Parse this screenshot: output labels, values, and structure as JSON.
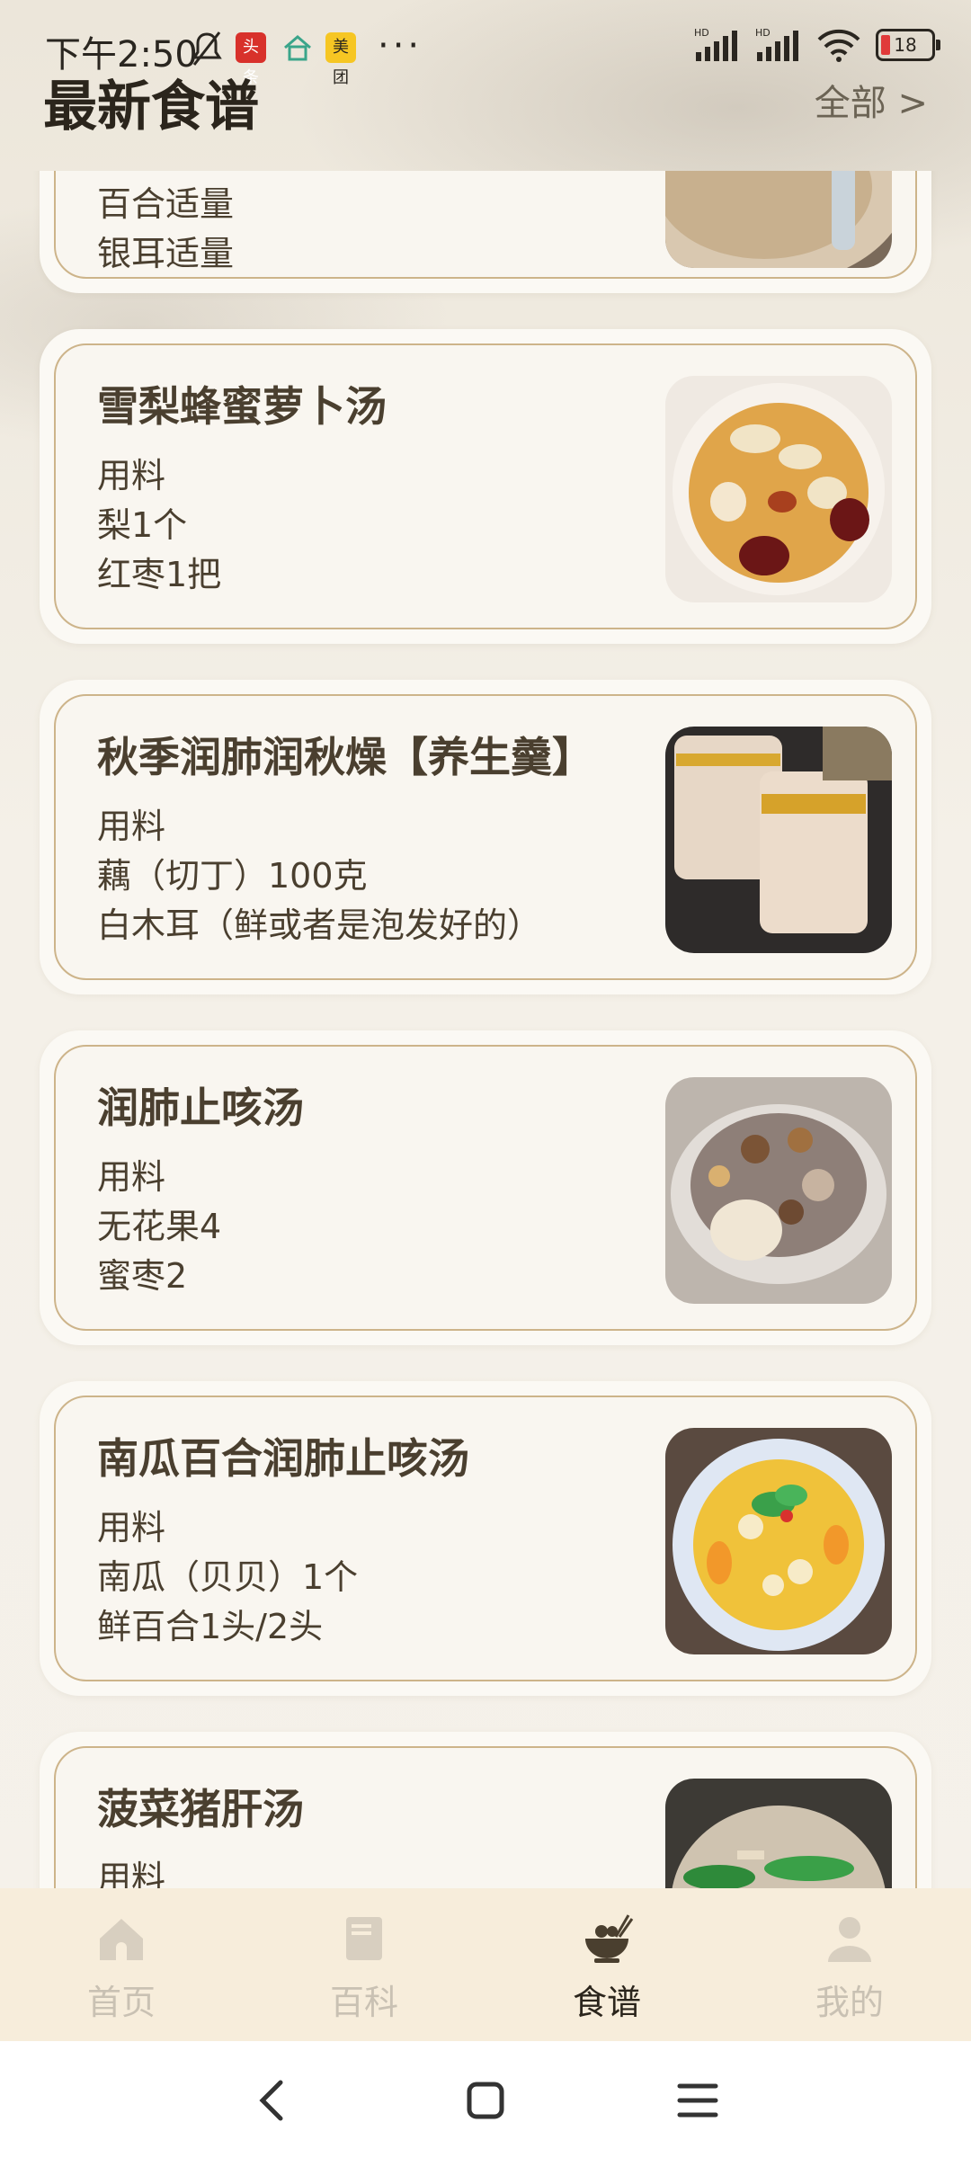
{
  "status_bar": {
    "time": "下午2:50",
    "app_badges": [
      "头条",
      "美团"
    ],
    "more": "···",
    "battery": "18"
  },
  "header": {
    "title": "最新食谱",
    "see_all": "全部 >"
  },
  "recipes": [
    {
      "title": "",
      "lines": [
        "百合适量",
        "银耳适量"
      ]
    },
    {
      "title": "雪梨蜂蜜萝卜汤",
      "lines": [
        "用料",
        "梨1个",
        "红枣1把"
      ]
    },
    {
      "title": "秋季润肺润秋燥【养生羹】",
      "lines": [
        "用料",
        "藕（切丁）100克",
        "白木耳（鲜或者是泡发好的）"
      ]
    },
    {
      "title": "润肺止咳汤",
      "lines": [
        "用料",
        "无花果4",
        "蜜枣2"
      ]
    },
    {
      "title": "南瓜百合润肺止咳汤",
      "lines": [
        "用料",
        "南瓜（贝贝）1个",
        "鲜百合1头/2头"
      ]
    },
    {
      "title": "菠菜猪肝汤",
      "lines": [
        "用料"
      ]
    }
  ],
  "tabs": [
    {
      "label": "首页",
      "icon": "home-icon"
    },
    {
      "label": "百科",
      "icon": "book-icon"
    },
    {
      "label": "食谱",
      "icon": "bowl-icon"
    },
    {
      "label": "我的",
      "icon": "user-icon"
    }
  ],
  "active_tab": 2,
  "colors": {
    "accent": "#cdb48a",
    "tab_bar": "#f7eddb",
    "battery_low": "#e03a3a"
  }
}
